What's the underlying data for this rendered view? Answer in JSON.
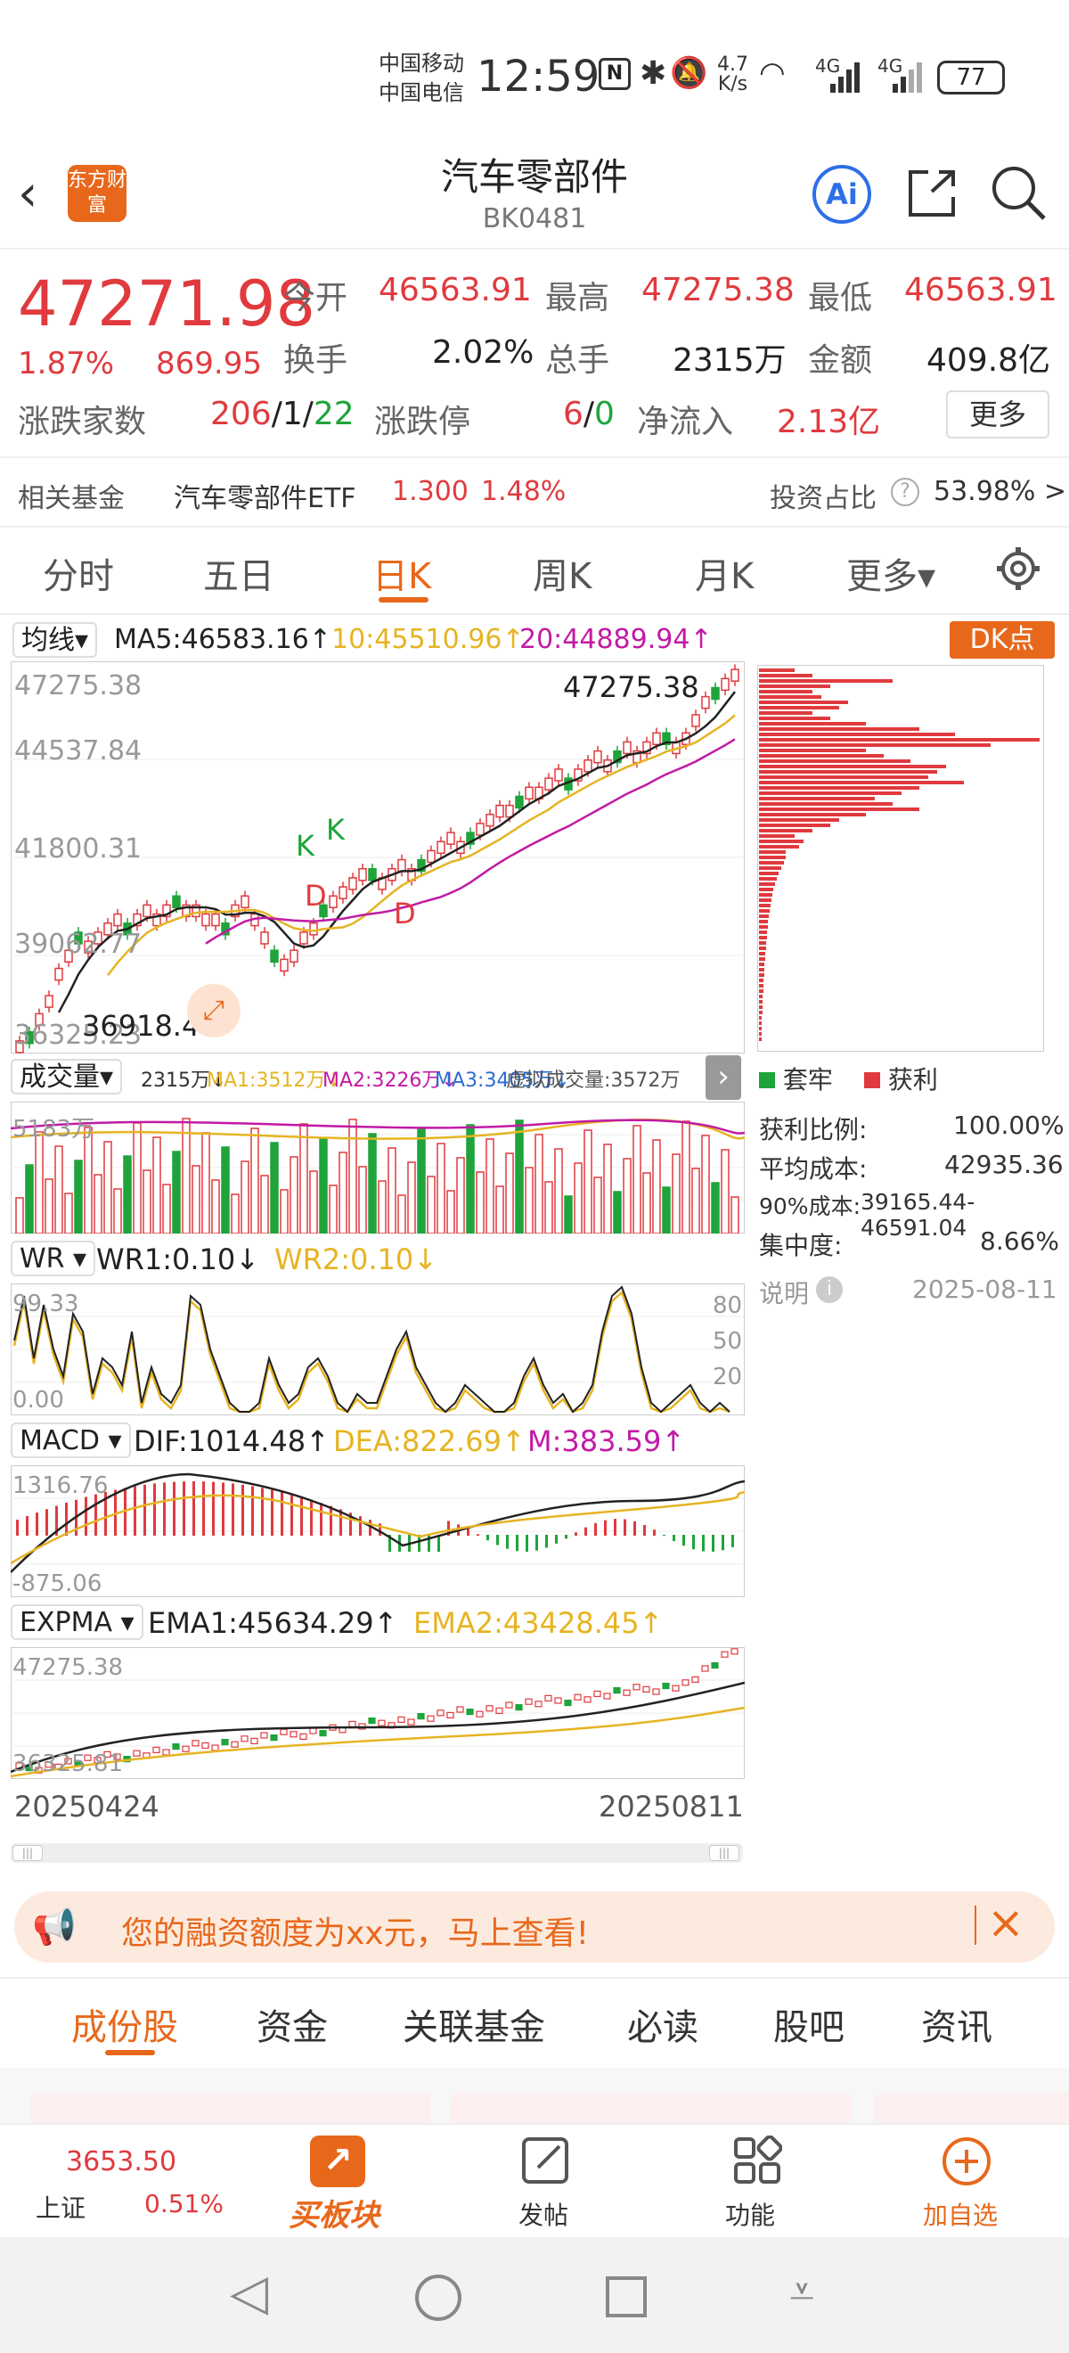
{
  "status_bar": {
    "carrier1": "中国移动",
    "carrier2": "中国电信",
    "time": "12:59",
    "net_speed_top": "4.7",
    "net_speed_unit": "K/s",
    "signal1": "4G",
    "signal2": "4G",
    "battery": "77"
  },
  "header": {
    "logo_text": "东方财富",
    "title": "汽车零部件",
    "code": "BK0481",
    "ai_label": "Ai"
  },
  "quote": {
    "price": "47271.98",
    "change_pct": "1.87%",
    "change_abs": "869.95",
    "open_label": "今开",
    "open": "46563.91",
    "high_label": "最高",
    "high": "47275.38",
    "low_label": "最低",
    "low": "46563.91",
    "turnover_label": "换手",
    "turnover": "2.02%",
    "volume_label": "总手",
    "volume": "2315万",
    "amount_label": "金额",
    "amount": "409.8亿",
    "updown_label": "涨跌家数",
    "up_count": "206",
    "sep1": "/",
    "flat_count": "1",
    "sep2": "/",
    "down_count": "22",
    "limit_label": "涨跌停",
    "limit_up": "6",
    "sep3": "/",
    "limit_down": "0",
    "netflow_label": "净流入",
    "netflow": "2.13亿",
    "more_btn": "更多"
  },
  "fund": {
    "label": "相关基金",
    "name": "汽车零部件ETF",
    "price": "1.300",
    "pct": "1.48%",
    "ratio_label": "投资占比",
    "ratio": "53.98% >"
  },
  "tabs": [
    "分时",
    "五日",
    "日K",
    "周K",
    "月K",
    "更多▾"
  ],
  "kline": {
    "ma_select": "均线▾",
    "ma5": "MA5:46583.16↑",
    "ma10": "10:45510.96↑",
    "ma20": "20:44889.94↑",
    "dk_btn": "DK点",
    "y_labels": [
      "47275.38",
      "44537.84",
      "41800.31",
      "39062.77",
      "36325.23"
    ],
    "max_tag": "47275.38",
    "min_tag": "36918.44",
    "k_mark": "K",
    "d_mark": "D"
  },
  "volume": {
    "select": "成交量▾",
    "v": "2315万↓",
    "ma1": "MA1:3512万↓",
    "ma2": "MA2:3226万↓",
    "ma3": "MA3:3405万↓",
    "virtual": "虚拟成交量:3572万",
    "y_top": "5183万"
  },
  "wr": {
    "select": "WR ▾",
    "wr1": "WR1:0.10↓",
    "wr2": "WR2:0.10↓",
    "y_top": "99.33",
    "y_bottom": "0.00",
    "r80": "80",
    "r50": "50",
    "r20": "20"
  },
  "macd": {
    "select": "MACD ▾",
    "dif": "DIF:1014.48↑",
    "dea": "DEA:822.69↑",
    "m": "M:383.59↑",
    "y_top": "1316.76",
    "y_bottom": "-875.06"
  },
  "expma": {
    "select": "EXPMA ▾",
    "ema1": "EMA1:45634.29↑",
    "ema2": "EMA2:43428.45↑",
    "y_top": "47275.38",
    "y_bottom": "36325.81"
  },
  "dates": {
    "start": "20250424",
    "end": "20250811"
  },
  "chips": {
    "legend_trapped": "套牢",
    "legend_profit": "获利",
    "profit_ratio_label": "获利比例:",
    "profit_ratio": "100.00%",
    "avg_cost_label": "平均成本:",
    "avg_cost": "42935.36",
    "cost90_label": "90%成本:",
    "cost90": "39165.44-46591.04",
    "concentration_label": "集中度:",
    "concentration": "8.66%",
    "note_label": "说明",
    "note_date": "2025-08-11"
  },
  "banner": {
    "text": "您的融资额度为xx元，马上查看!"
  },
  "bottom_tabs": [
    "成份股",
    "资金",
    "关联基金",
    "必读",
    "股吧",
    "资讯"
  ],
  "bottom_nav": {
    "index_value": "3653.50",
    "index_name": "上证",
    "index_pct": "0.51%",
    "buy_label": "买板块",
    "post_label": "发帖",
    "func_label": "功能",
    "add_label": "加自选"
  },
  "colors": {
    "up": "#e03a3e",
    "down": "#1ea43a",
    "ma10": "#e6b422",
    "ma20": "#c21aa5",
    "accent": "#e8681b"
  }
}
